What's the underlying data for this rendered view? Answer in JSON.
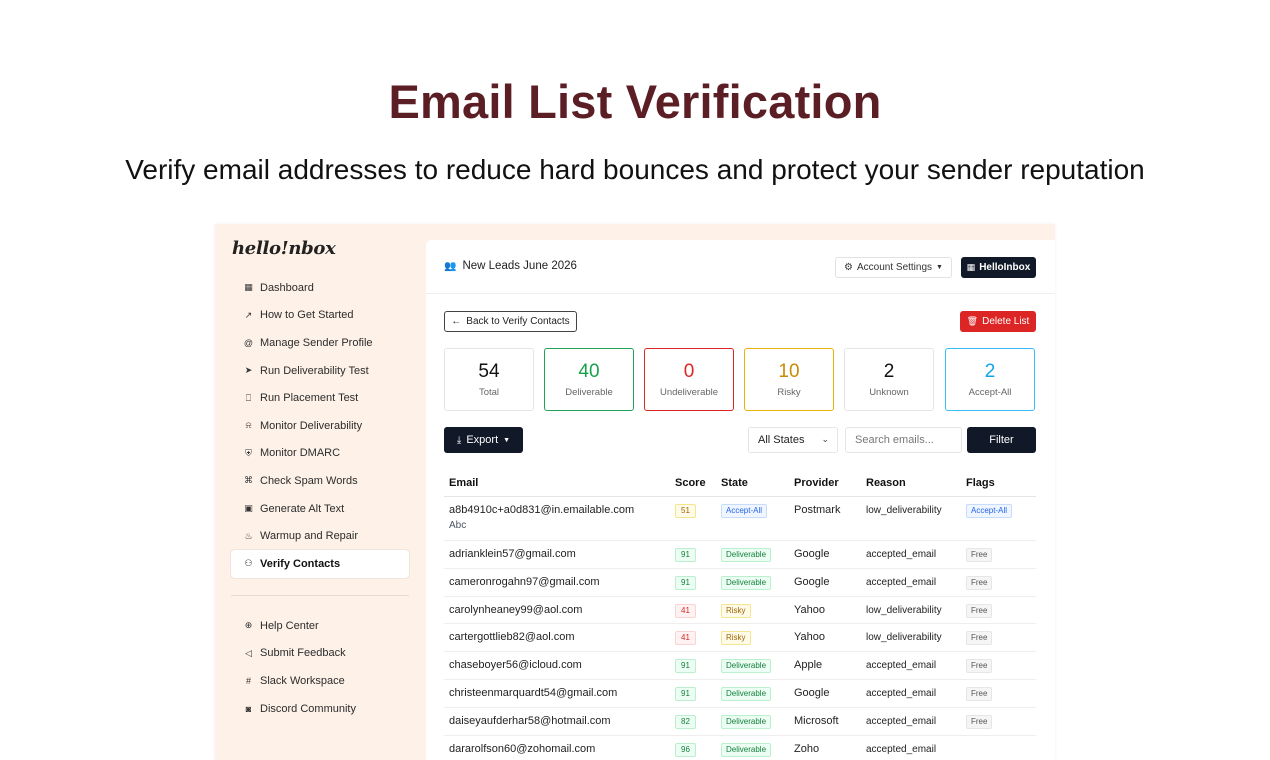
{
  "hero": {
    "title": "Email List Verification",
    "subtitle": "Verify email addresses to reduce hard bounces and protect your sender reputation"
  },
  "app": {
    "logo": "hello!nbox",
    "nav": [
      {
        "label": "Dashboard",
        "icon": "grid-icon"
      },
      {
        "label": "How to Get Started",
        "icon": "rocket-icon"
      },
      {
        "label": "Manage Sender Profile",
        "icon": "at-sign-icon"
      },
      {
        "label": "Run Deliverability Test",
        "icon": "send-icon"
      },
      {
        "label": "Run Placement Test",
        "icon": "inbox-icon"
      },
      {
        "label": "Monitor Deliverability",
        "icon": "bell-icon"
      },
      {
        "label": "Monitor DMARC",
        "icon": "shield-icon"
      },
      {
        "label": "Check Spam Words",
        "icon": "bug-icon"
      },
      {
        "label": "Generate Alt Text",
        "icon": "image-icon"
      },
      {
        "label": "Warmup and Repair",
        "icon": "flame-icon"
      },
      {
        "label": "Verify Contacts",
        "icon": "users-icon",
        "active": true
      }
    ],
    "nav_secondary": [
      {
        "label": "Help Center",
        "icon": "lifebuoy-icon"
      },
      {
        "label": "Submit Feedback",
        "icon": "megaphone-icon"
      },
      {
        "label": "Slack Workspace",
        "icon": "slack-icon"
      },
      {
        "label": "Discord Community",
        "icon": "discord-icon"
      }
    ],
    "header": {
      "list_name": "New Leads June 2026",
      "account_settings": "Account Settings",
      "brand_button": "HelloInbox"
    },
    "actions": {
      "back": "Back to Verify Contacts",
      "delete": "Delete List"
    },
    "stats": [
      {
        "value": "54",
        "label": "Total",
        "tone": "neutral"
      },
      {
        "value": "40",
        "label": "Deliverable",
        "tone": "green"
      },
      {
        "value": "0",
        "label": "Undeliverable",
        "tone": "red"
      },
      {
        "value": "10",
        "label": "Risky",
        "tone": "yellow"
      },
      {
        "value": "2",
        "label": "Unknown",
        "tone": "neutral"
      },
      {
        "value": "2",
        "label": "Accept-All",
        "tone": "blue"
      }
    ],
    "toolbar": {
      "export": "Export",
      "states_value": "All States",
      "search_placeholder": "Search emails...",
      "filter": "Filter"
    },
    "table": {
      "columns": [
        "Email",
        "Score",
        "State",
        "Provider",
        "Reason",
        "Flags"
      ],
      "rows": [
        {
          "email": "a8b4910c+a0d831@in.emailable.com",
          "name": "Abc",
          "score": "51",
          "score_tone": "yellow",
          "state": "Accept-All",
          "state_tone": "blue",
          "provider": "Postmark",
          "reason": "low_deliverability",
          "flag": "Accept-All",
          "flag_tone": "blue"
        },
        {
          "email": "adrianklein57@gmail.com",
          "name": "",
          "score": "91",
          "score_tone": "green",
          "state": "Deliverable",
          "state_tone": "green",
          "provider": "Google",
          "reason": "accepted_email",
          "flag": "Free",
          "flag_tone": "gray"
        },
        {
          "email": "cameronrogahn97@gmail.com",
          "name": "",
          "score": "91",
          "score_tone": "green",
          "state": "Deliverable",
          "state_tone": "green",
          "provider": "Google",
          "reason": "accepted_email",
          "flag": "Free",
          "flag_tone": "gray"
        },
        {
          "email": "carolynheaney99@aol.com",
          "name": "",
          "score": "41",
          "score_tone": "red",
          "state": "Risky",
          "state_tone": "yellow",
          "provider": "Yahoo",
          "reason": "low_deliverability",
          "flag": "Free",
          "flag_tone": "gray"
        },
        {
          "email": "cartergottlieb82@aol.com",
          "name": "",
          "score": "41",
          "score_tone": "red",
          "state": "Risky",
          "state_tone": "yellow",
          "provider": "Yahoo",
          "reason": "low_deliverability",
          "flag": "Free",
          "flag_tone": "gray"
        },
        {
          "email": "chaseboyer56@icloud.com",
          "name": "",
          "score": "91",
          "score_tone": "green",
          "state": "Deliverable",
          "state_tone": "green",
          "provider": "Apple",
          "reason": "accepted_email",
          "flag": "Free",
          "flag_tone": "gray"
        },
        {
          "email": "christeenmarquardt54@gmail.com",
          "name": "",
          "score": "91",
          "score_tone": "green",
          "state": "Deliverable",
          "state_tone": "green",
          "provider": "Google",
          "reason": "accepted_email",
          "flag": "Free",
          "flag_tone": "gray"
        },
        {
          "email": "daiseyaufderhar58@hotmail.com",
          "name": "",
          "score": "82",
          "score_tone": "green",
          "state": "Deliverable",
          "state_tone": "green",
          "provider": "Microsoft",
          "reason": "accepted_email",
          "flag": "Free",
          "flag_tone": "gray"
        },
        {
          "email": "dararolfson60@zohomail.com",
          "name": "",
          "score": "96",
          "score_tone": "green",
          "state": "Deliverable",
          "state_tone": "green",
          "provider": "Zoho",
          "reason": "accepted_email",
          "flag": "",
          "flag_tone": "gray"
        }
      ]
    }
  }
}
